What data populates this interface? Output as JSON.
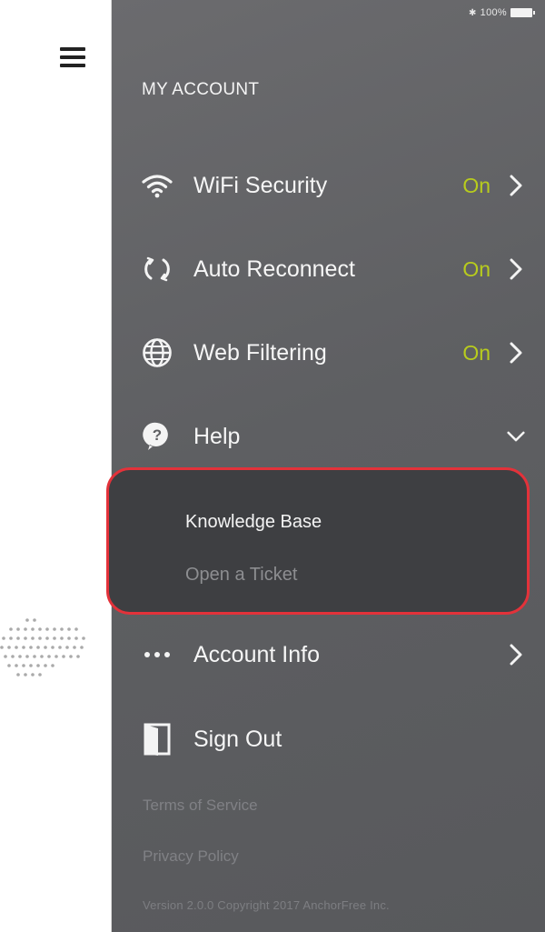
{
  "status_bar": {
    "battery_text": "100%"
  },
  "drawer": {
    "section_title": "MY ACCOUNT",
    "items": [
      {
        "label": "WiFi Security",
        "status": "On",
        "icon": "wifi-icon"
      },
      {
        "label": "Auto Reconnect",
        "status": "On",
        "icon": "reconnect-icon"
      },
      {
        "label": "Web Filtering",
        "status": "On",
        "icon": "globe-icon"
      },
      {
        "label": "Help",
        "icon": "help-icon",
        "expanded": true
      }
    ],
    "help_submenu": [
      {
        "label": "Knowledge Base"
      },
      {
        "label": "Open a Ticket"
      }
    ],
    "account_info": {
      "label": "Account Info",
      "icon": "more-dots-icon"
    },
    "sign_out": {
      "label": "Sign Out",
      "icon": "door-icon"
    },
    "footer": {
      "terms": "Terms of Service",
      "privacy": "Privacy Policy",
      "copyright": "Version 2.0.0 Copyright 2017 AnchorFree Inc."
    }
  },
  "colors": {
    "drawer_bg": "#5e5f62",
    "status_on": "#b8cc1d",
    "highlight_border": "#e3323a",
    "submenu_bg": "#3e3f42"
  }
}
